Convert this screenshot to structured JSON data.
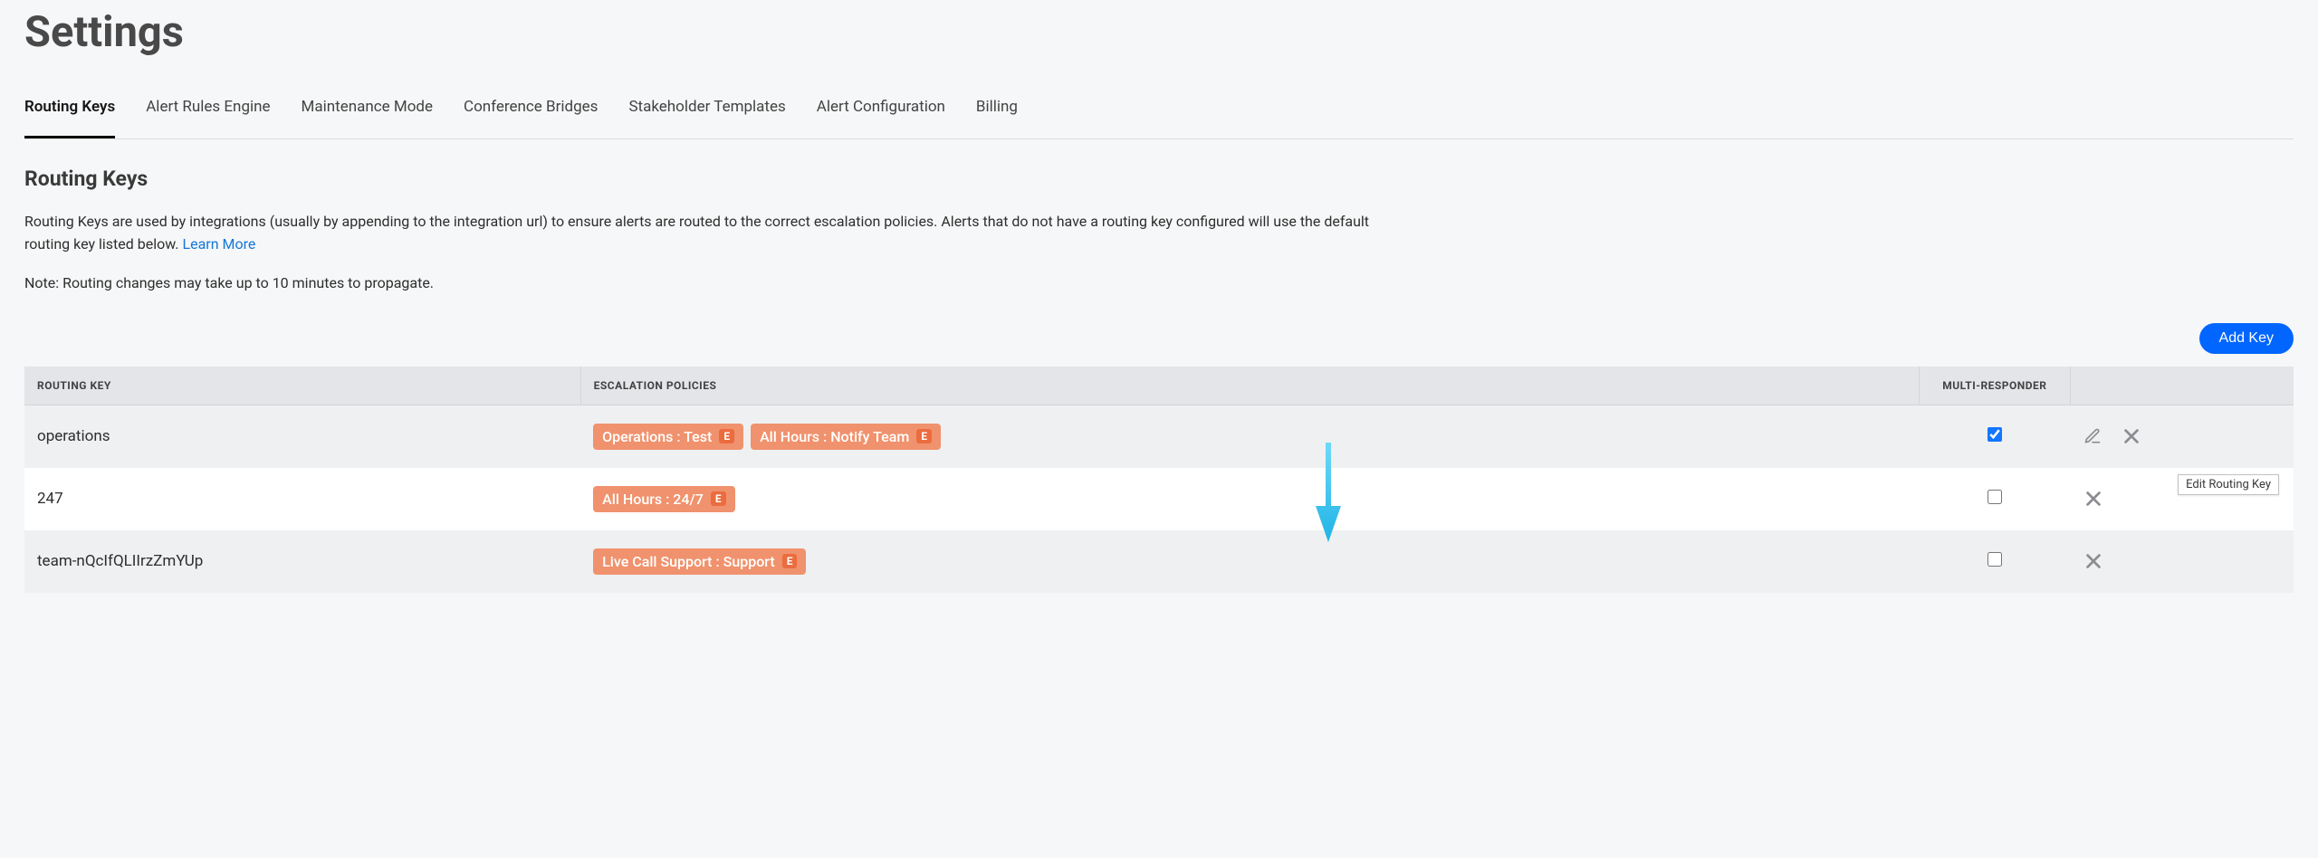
{
  "page_title": "Settings",
  "tabs": [
    {
      "label": "Routing Keys",
      "active": true
    },
    {
      "label": "Alert Rules Engine",
      "active": false
    },
    {
      "label": "Maintenance Mode",
      "active": false
    },
    {
      "label": "Conference Bridges",
      "active": false
    },
    {
      "label": "Stakeholder Templates",
      "active": false
    },
    {
      "label": "Alert Configuration",
      "active": false
    },
    {
      "label": "Billing",
      "active": false
    }
  ],
  "section_title": "Routing Keys",
  "description_text": "Routing Keys are used by integrations (usually by appending to the integration url) to ensure alerts are routed to the correct escalation policies. Alerts that do not have a routing key configured will use the default routing key listed below. ",
  "learn_more_label": "Learn More",
  "note_text": "Note: Routing changes may take up to 10 minutes to propagate.",
  "add_key_label": "Add Key",
  "table": {
    "headers": {
      "key": "ROUTING KEY",
      "policies": "ESCALATION POLICIES",
      "multi": "MULTI-RESPONDER"
    },
    "rows": [
      {
        "key": "operations",
        "policies": [
          {
            "label": "Operations : Test",
            "chip": "E"
          },
          {
            "label": "All Hours : Notify Team",
            "chip": "E"
          }
        ],
        "multi_checked": true,
        "show_edit": true,
        "show_delete": true,
        "show_tooltip": true
      },
      {
        "key": "247",
        "policies": [
          {
            "label": "All Hours : 24/7",
            "chip": "E"
          }
        ],
        "multi_checked": false,
        "show_edit": false,
        "show_delete": true,
        "show_tooltip": false
      },
      {
        "key": "team-nQcIfQLIIrzZmYUp",
        "policies": [
          {
            "label": "Live Call Support : Support",
            "chip": "E"
          }
        ],
        "multi_checked": false,
        "show_edit": false,
        "show_delete": true,
        "show_tooltip": false
      }
    ]
  },
  "tooltip_text": "Edit Routing Key",
  "colors": {
    "accent": "#0066ff",
    "link": "#1276d9",
    "badge": "#f0926d",
    "badge_chip": "#eb6c3f",
    "arrow": "#40bff0"
  }
}
